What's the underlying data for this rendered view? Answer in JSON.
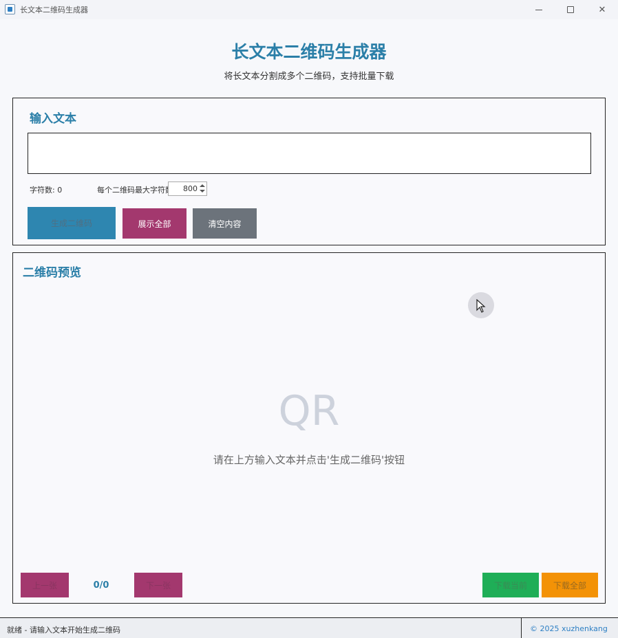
{
  "window": {
    "title": "长文本二维码生成器"
  },
  "header": {
    "title": "长文本二维码生成器",
    "subtitle": "将长文本分割成多个二维码，支持批量下载"
  },
  "input_section": {
    "title": "输入文本",
    "text_value": "",
    "char_count_label": "字符数: 0",
    "max_chars_label": "每个二维码最大字符数:",
    "max_chars_value": "800",
    "buttons": {
      "generate": "生成二维码",
      "show_all": "展示全部",
      "clear": "清空内容"
    }
  },
  "preview_section": {
    "title": "二维码预览",
    "placeholder_glyph": "QR",
    "empty_hint": "请在上方输入文本并点击'生成二维码'按钮",
    "prev_button": "上一张",
    "page_indicator": "0/0",
    "next_button": "下一张",
    "download_current": "下载当前",
    "download_all": "下载全部"
  },
  "statusbar": {
    "status": "就绪 - 请输入文本开始生成二维码",
    "copyright": "© 2025 xuzhenkang"
  },
  "colors": {
    "accent_blue": "#2b7fa8",
    "magenta": "#a3386e",
    "gray_button": "#6c737b",
    "green": "#1fae57",
    "orange": "#f39206"
  }
}
